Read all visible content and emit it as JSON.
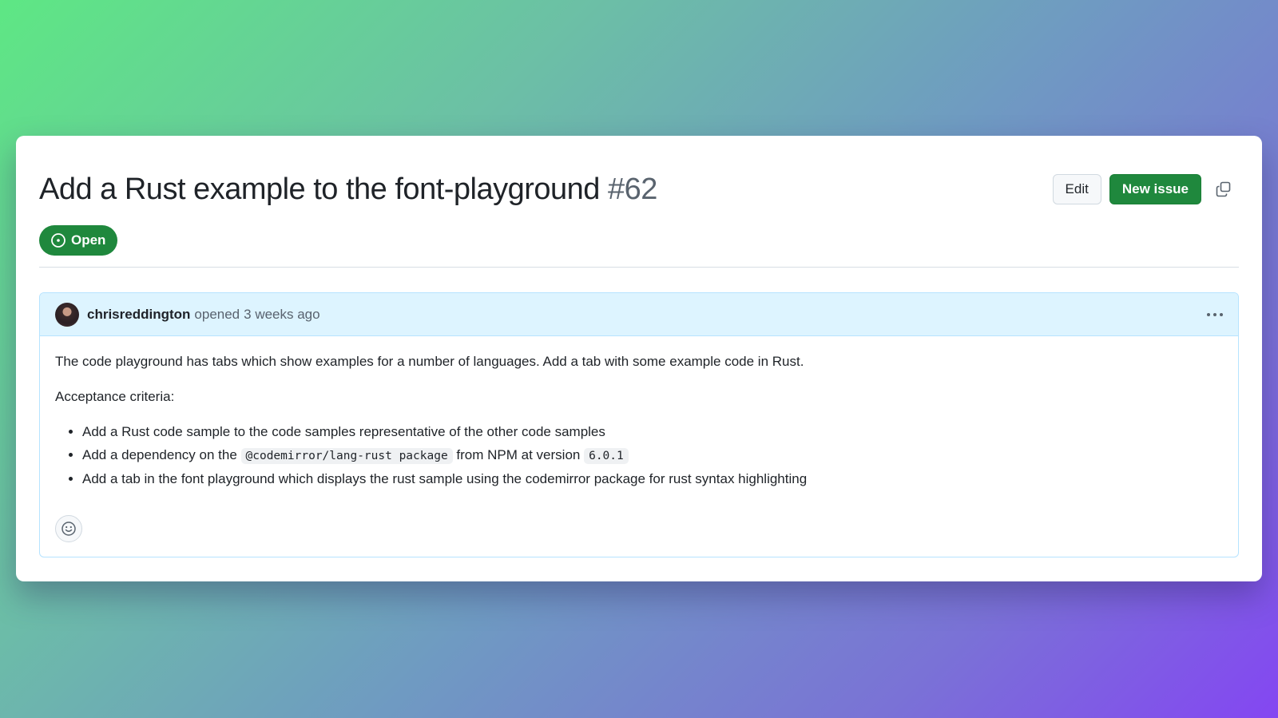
{
  "issue": {
    "title": "Add a Rust example to the font-playground",
    "number": "#62",
    "state": "Open",
    "state_color": "#1f883d",
    "state_icon": "issue-opened-icon"
  },
  "actions": {
    "edit_label": "Edit",
    "new_issue_label": "New issue",
    "copy_icon": "copy-icon"
  },
  "comment": {
    "author": "chrisreddington",
    "action": "opened",
    "time": "3 weeks ago",
    "more_icon": "kebab-horizontal-icon",
    "body": {
      "paragraph": "The code playground has tabs which show examples for a number of languages. Add a tab with some example code in Rust.",
      "criteria_heading": "Acceptance criteria:",
      "items": [
        {
          "text": "Add a Rust code sample to the code samples representative of the other code samples"
        },
        {
          "prefix": "Add a dependency on the",
          "code": "@codemirror/lang-rust package",
          "middle": "from NPM at version",
          "code2": "6.0.1"
        },
        {
          "text": "Add a tab in the font playground which displays the rust sample using the codemirror package for rust syntax highlighting"
        }
      ]
    },
    "reaction_icon": "smiley-icon"
  }
}
